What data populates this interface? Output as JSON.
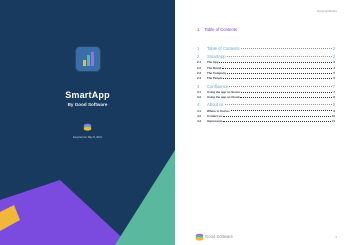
{
  "cover": {
    "app_name": "SmartApp",
    "subtitle": "By Good Software",
    "exported": "Exported on May 8, 2021",
    "colors": {
      "background": "#183a5e",
      "purple": "#7b4be0",
      "teal": "#5ab89e",
      "yellow": "#f0b73a"
    }
  },
  "page": {
    "header_brand": "Good Software",
    "toc_heading": {
      "number": "1",
      "title": "Table of Contents"
    },
    "toc": [
      {
        "n": "1",
        "title": "Table of Contents",
        "page": "2",
        "level": "major"
      },
      {
        "n": "2",
        "title": "SmartApp",
        "page": "3",
        "level": "major"
      },
      {
        "n": "2.1",
        "title": "The App",
        "page": "3",
        "level": "minor"
      },
      {
        "n": "2.2",
        "title": "The Brand",
        "page": "4",
        "level": "minor"
      },
      {
        "n": "2.3",
        "title": "The Company",
        "page": "5",
        "level": "minor"
      },
      {
        "n": "2.4",
        "title": "The People",
        "page": "6",
        "level": "minor"
      },
      {
        "n": "3",
        "title": "Confluence",
        "page": "7",
        "level": "major"
      },
      {
        "n": "3.1",
        "title": "Using the app on Server",
        "page": "7",
        "level": "minor"
      },
      {
        "n": "3.2",
        "title": "Using the app on Cloud",
        "page": "8",
        "level": "minor"
      },
      {
        "n": "4",
        "title": "About us",
        "page": "9",
        "level": "major"
      },
      {
        "n": "4.1",
        "title": "Where to find us",
        "page": "9",
        "level": "minor"
      },
      {
        "n": "4.2",
        "title": "Contact us",
        "page": "10",
        "level": "minor"
      },
      {
        "n": "4.3",
        "title": "Impressum",
        "page": "11",
        "level": "minor"
      }
    ],
    "footer_brand": "Good Software",
    "page_number": "2",
    "colors": {
      "heading": "#7b3fe4",
      "major": "#6aa8c9",
      "minor": "#333a44"
    }
  }
}
